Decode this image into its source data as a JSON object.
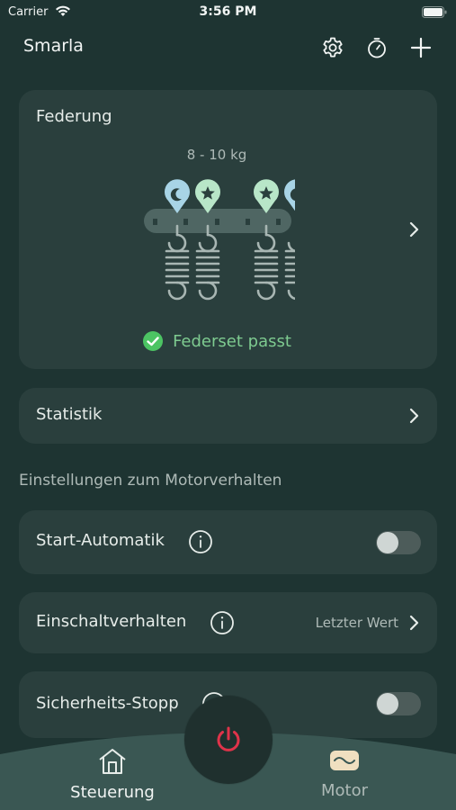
{
  "status_bar": {
    "carrier": "Carrier",
    "time": "3:56 PM"
  },
  "header": {
    "title": "Smarla",
    "icons": [
      "gear-icon",
      "timer-icon",
      "plus-icon"
    ]
  },
  "spring_card": {
    "title": "Federung",
    "weight_range": "8 - 10 kg",
    "status": "Federset passt",
    "status_color": "#4cc463"
  },
  "statistics": {
    "label": "Statistik"
  },
  "motor_section": {
    "heading": "Einstellungen zum Motorverhalten",
    "start_auto": {
      "label": "Start-Automatik",
      "enabled": false
    },
    "switch_on": {
      "label": "Einschaltverhalten",
      "value": "Letzter Wert"
    },
    "safety_stop": {
      "label": "Sicherheits-Stopp",
      "enabled": false
    }
  },
  "tab_bar": {
    "tabs": [
      {
        "label": "Steuerung",
        "icon": "home-icon",
        "active": true
      },
      {
        "label": "Motor",
        "icon": "motor-icon",
        "active": false
      }
    ],
    "power_icon": "power-icon",
    "power_color": "#e0334a"
  },
  "colors": {
    "background": "#1e3432",
    "card": "#2a3f3d",
    "tab_bar": "#3a5753",
    "accent_green": "#7ecb90",
    "pin_blue": "#a8d4e6",
    "pin_mint": "#b8e6c8"
  }
}
